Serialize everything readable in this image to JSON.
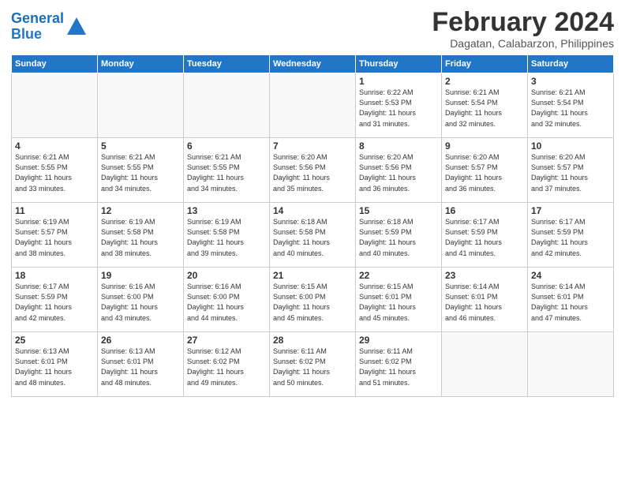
{
  "logo": {
    "line1": "General",
    "line2": "Blue"
  },
  "title": "February 2024",
  "location": "Dagatan, Calabarzon, Philippines",
  "days_of_week": [
    "Sunday",
    "Monday",
    "Tuesday",
    "Wednesday",
    "Thursday",
    "Friday",
    "Saturday"
  ],
  "weeks": [
    [
      {
        "day": "",
        "info": ""
      },
      {
        "day": "",
        "info": ""
      },
      {
        "day": "",
        "info": ""
      },
      {
        "day": "",
        "info": ""
      },
      {
        "day": "1",
        "info": "Sunrise: 6:22 AM\nSunset: 5:53 PM\nDaylight: 11 hours\nand 31 minutes."
      },
      {
        "day": "2",
        "info": "Sunrise: 6:21 AM\nSunset: 5:54 PM\nDaylight: 11 hours\nand 32 minutes."
      },
      {
        "day": "3",
        "info": "Sunrise: 6:21 AM\nSunset: 5:54 PM\nDaylight: 11 hours\nand 32 minutes."
      }
    ],
    [
      {
        "day": "4",
        "info": "Sunrise: 6:21 AM\nSunset: 5:55 PM\nDaylight: 11 hours\nand 33 minutes."
      },
      {
        "day": "5",
        "info": "Sunrise: 6:21 AM\nSunset: 5:55 PM\nDaylight: 11 hours\nand 34 minutes."
      },
      {
        "day": "6",
        "info": "Sunrise: 6:21 AM\nSunset: 5:55 PM\nDaylight: 11 hours\nand 34 minutes."
      },
      {
        "day": "7",
        "info": "Sunrise: 6:20 AM\nSunset: 5:56 PM\nDaylight: 11 hours\nand 35 minutes."
      },
      {
        "day": "8",
        "info": "Sunrise: 6:20 AM\nSunset: 5:56 PM\nDaylight: 11 hours\nand 36 minutes."
      },
      {
        "day": "9",
        "info": "Sunrise: 6:20 AM\nSunset: 5:57 PM\nDaylight: 11 hours\nand 36 minutes."
      },
      {
        "day": "10",
        "info": "Sunrise: 6:20 AM\nSunset: 5:57 PM\nDaylight: 11 hours\nand 37 minutes."
      }
    ],
    [
      {
        "day": "11",
        "info": "Sunrise: 6:19 AM\nSunset: 5:57 PM\nDaylight: 11 hours\nand 38 minutes."
      },
      {
        "day": "12",
        "info": "Sunrise: 6:19 AM\nSunset: 5:58 PM\nDaylight: 11 hours\nand 38 minutes."
      },
      {
        "day": "13",
        "info": "Sunrise: 6:19 AM\nSunset: 5:58 PM\nDaylight: 11 hours\nand 39 minutes."
      },
      {
        "day": "14",
        "info": "Sunrise: 6:18 AM\nSunset: 5:58 PM\nDaylight: 11 hours\nand 40 minutes."
      },
      {
        "day": "15",
        "info": "Sunrise: 6:18 AM\nSunset: 5:59 PM\nDaylight: 11 hours\nand 40 minutes."
      },
      {
        "day": "16",
        "info": "Sunrise: 6:17 AM\nSunset: 5:59 PM\nDaylight: 11 hours\nand 41 minutes."
      },
      {
        "day": "17",
        "info": "Sunrise: 6:17 AM\nSunset: 5:59 PM\nDaylight: 11 hours\nand 42 minutes."
      }
    ],
    [
      {
        "day": "18",
        "info": "Sunrise: 6:17 AM\nSunset: 5:59 PM\nDaylight: 11 hours\nand 42 minutes."
      },
      {
        "day": "19",
        "info": "Sunrise: 6:16 AM\nSunset: 6:00 PM\nDaylight: 11 hours\nand 43 minutes."
      },
      {
        "day": "20",
        "info": "Sunrise: 6:16 AM\nSunset: 6:00 PM\nDaylight: 11 hours\nand 44 minutes."
      },
      {
        "day": "21",
        "info": "Sunrise: 6:15 AM\nSunset: 6:00 PM\nDaylight: 11 hours\nand 45 minutes."
      },
      {
        "day": "22",
        "info": "Sunrise: 6:15 AM\nSunset: 6:01 PM\nDaylight: 11 hours\nand 45 minutes."
      },
      {
        "day": "23",
        "info": "Sunrise: 6:14 AM\nSunset: 6:01 PM\nDaylight: 11 hours\nand 46 minutes."
      },
      {
        "day": "24",
        "info": "Sunrise: 6:14 AM\nSunset: 6:01 PM\nDaylight: 11 hours\nand 47 minutes."
      }
    ],
    [
      {
        "day": "25",
        "info": "Sunrise: 6:13 AM\nSunset: 6:01 PM\nDaylight: 11 hours\nand 48 minutes."
      },
      {
        "day": "26",
        "info": "Sunrise: 6:13 AM\nSunset: 6:01 PM\nDaylight: 11 hours\nand 48 minutes."
      },
      {
        "day": "27",
        "info": "Sunrise: 6:12 AM\nSunset: 6:02 PM\nDaylight: 11 hours\nand 49 minutes."
      },
      {
        "day": "28",
        "info": "Sunrise: 6:11 AM\nSunset: 6:02 PM\nDaylight: 11 hours\nand 50 minutes."
      },
      {
        "day": "29",
        "info": "Sunrise: 6:11 AM\nSunset: 6:02 PM\nDaylight: 11 hours\nand 51 minutes."
      },
      {
        "day": "",
        "info": ""
      },
      {
        "day": "",
        "info": ""
      }
    ]
  ]
}
